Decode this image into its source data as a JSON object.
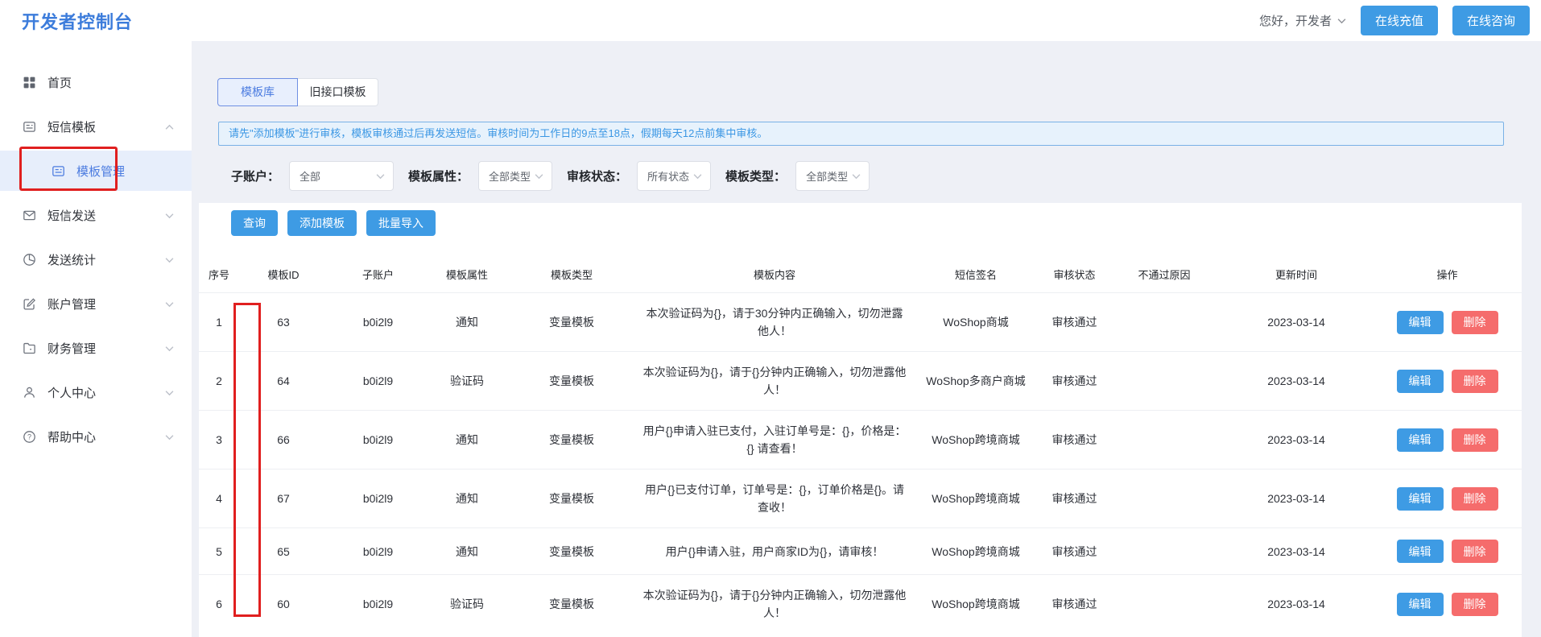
{
  "header": {
    "title": "开发者控制台",
    "greeting": "您好，开发者",
    "recharge_button": "在线充值",
    "consult_button": "在线咨询"
  },
  "sidebar": {
    "items": [
      {
        "label": "首页",
        "icon": "home-grid-icon"
      },
      {
        "label": "短信模板",
        "icon": "template-icon",
        "expanded": true
      },
      {
        "label": "模板管理",
        "icon": "template-icon",
        "active": true,
        "submenu_of": "短信模板"
      },
      {
        "label": "短信发送",
        "icon": "mail-icon"
      },
      {
        "label": "发送统计",
        "icon": "pie-chart-icon"
      },
      {
        "label": "账户管理",
        "icon": "edit-icon"
      },
      {
        "label": "财务管理",
        "icon": "folder-icon"
      },
      {
        "label": "个人中心",
        "icon": "user-icon"
      },
      {
        "label": "帮助中心",
        "icon": "help-icon"
      }
    ]
  },
  "tabs": [
    {
      "label": "模板库",
      "active": true
    },
    {
      "label": "旧接口模板",
      "active": false
    }
  ],
  "notice": {
    "text": "请先\"添加模板\"进行审核，模板审核通过后再发送短信。审核时间为工作日的9点至18点，假期每天12点前集中审核。"
  },
  "filters": [
    {
      "label": "子账户：",
      "value": "全部"
    },
    {
      "label": "模板属性：",
      "value": "全部类型"
    },
    {
      "label": "审核状态：",
      "value": "所有状态"
    },
    {
      "label": "模板类型：",
      "value": "全部类型"
    }
  ],
  "actions": {
    "query": "查询",
    "add": "添加模板",
    "batch_import": "批量导入"
  },
  "table": {
    "columns": [
      "序号",
      "模板ID",
      "子账户",
      "模板属性",
      "模板类型",
      "模板内容",
      "短信签名",
      "审核状态",
      "不通过原因",
      "更新时间",
      "操作"
    ],
    "edit_label": "编辑",
    "delete_label": "删除",
    "rows": [
      {
        "index": "1",
        "template_id": "63",
        "sub_account": "b0i2l9",
        "attribute": "通知",
        "type": "变量模板",
        "content": "本次验证码为{}，请于30分钟内正确输入，切勿泄露他人！",
        "signature": "WoShop商城",
        "audit_status": "审核通过",
        "reject_reason": "",
        "updated": "2023-03-14"
      },
      {
        "index": "2",
        "template_id": "64",
        "sub_account": "b0i2l9",
        "attribute": "验证码",
        "type": "变量模板",
        "content": "本次验证码为{}，请于{}分钟内正确输入，切勿泄露他人！",
        "signature": "WoShop多商户商城",
        "audit_status": "审核通过",
        "reject_reason": "",
        "updated": "2023-03-14"
      },
      {
        "index": "3",
        "template_id": "66",
        "sub_account": "b0i2l9",
        "attribute": "通知",
        "type": "变量模板",
        "content": "用户{}申请入驻已支付，入驻订单号是：{}，价格是：{} 请查看！",
        "signature": "WoShop跨境商城",
        "audit_status": "审核通过",
        "reject_reason": "",
        "updated": "2023-03-14"
      },
      {
        "index": "4",
        "template_id": "67",
        "sub_account": "b0i2l9",
        "attribute": "通知",
        "type": "变量模板",
        "content": "用户{}已支付订单，订单号是：{}，订单价格是{}。请查收！",
        "signature": "WoShop跨境商城",
        "audit_status": "审核通过",
        "reject_reason": "",
        "updated": "2023-03-14"
      },
      {
        "index": "5",
        "template_id": "65",
        "sub_account": "b0i2l9",
        "attribute": "通知",
        "type": "变量模板",
        "content": "用户{}申请入驻，用户商家ID为{}，请审核！",
        "signature": "WoShop跨境商城",
        "audit_status": "审核通过",
        "reject_reason": "",
        "updated": "2023-03-14"
      },
      {
        "index": "6",
        "template_id": "60",
        "sub_account": "b0i2l9",
        "attribute": "验证码",
        "type": "变量模板",
        "content": "本次验证码为{}，请于{}分钟内正确输入，切勿泄露他人！",
        "signature": "WoShop跨境商城",
        "audit_status": "审核通过",
        "reject_reason": "",
        "updated": "2023-03-14"
      }
    ]
  },
  "annotations": {
    "red_box_1": "highlights sidebar item 模板管理",
    "red_box_2": "highlights 模板ID column values"
  },
  "colors": {
    "brand_blue": "#3c7cdb",
    "primary_button": "#3E9BE4",
    "danger_button": "#F56C6C",
    "active_nav_text": "#4c7ce0",
    "active_nav_bg": "#e7eefb",
    "notice_bg": "#e7f2fc",
    "notice_border": "#79b1e6",
    "notice_text": "#3b97e4",
    "annotation_red": "#e01f1f",
    "page_bg": "#eef0f6"
  }
}
